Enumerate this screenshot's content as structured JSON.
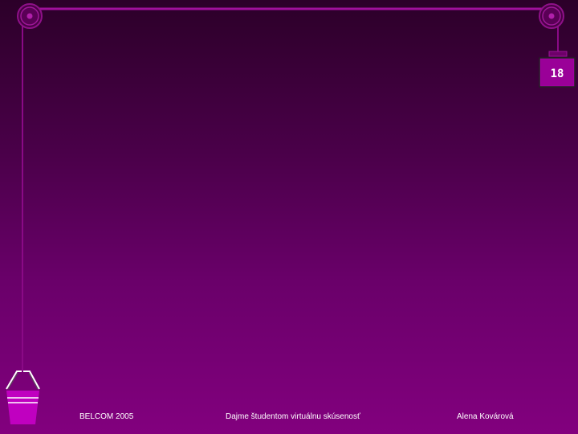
{
  "slide": {
    "page_number": "18",
    "footer": {
      "left": "BELCOM 2005",
      "center": "Dajme študentom virtuálnu skúsenosť",
      "right": "Alena Kovárová"
    }
  },
  "colors": {
    "background_top": "#2c0029",
    "background_bottom": "#82007e",
    "rope": "#a0109c",
    "bucket": "#c000c0",
    "text": "#ffffff"
  },
  "icons": [
    "pulley-icon",
    "weight-icon",
    "bucket-icon"
  ]
}
